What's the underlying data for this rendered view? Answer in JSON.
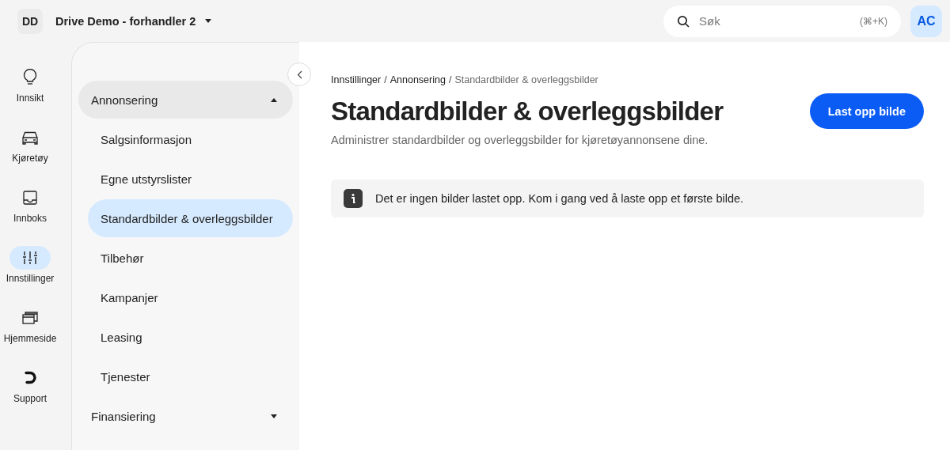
{
  "org": {
    "initials": "DD",
    "name": "Drive Demo - forhandler 2"
  },
  "search": {
    "placeholder": "Søk",
    "shortcut": "(⌘+K)"
  },
  "user": {
    "initials": "AC"
  },
  "rail": [
    {
      "label": "Innsikt",
      "selected": false
    },
    {
      "label": "Kjøretøy",
      "selected": false
    },
    {
      "label": "Innboks",
      "selected": false
    },
    {
      "label": "Innstillinger",
      "selected": true
    },
    {
      "label": "Hjemmeside",
      "selected": false
    },
    {
      "label": "Support",
      "selected": false
    }
  ],
  "menu": [
    {
      "kind": "group",
      "label": "Annonsering",
      "expanded": true,
      "children": [
        {
          "label": "Salgsinformasjon",
          "selected": false
        },
        {
          "label": "Egne utstyrslister",
          "selected": false
        },
        {
          "label": "Standardbilder & overleggsbilder",
          "selected": true
        },
        {
          "label": "Tilbehør",
          "selected": false
        },
        {
          "label": "Kampanjer",
          "selected": false
        },
        {
          "label": "Leasing",
          "selected": false
        },
        {
          "label": "Tjenester",
          "selected": false
        }
      ]
    },
    {
      "kind": "group",
      "label": "Finansiering",
      "expanded": false
    }
  ],
  "breadcrumb": {
    "separator": "/",
    "items": [
      "Innstillinger",
      "Annonsering",
      "Standardbilder & overleggsbilder"
    ]
  },
  "title": "Standardbilder & overleggsbilder",
  "subtitle": "Administrer standardbilder og overleggsbilder for kjøretøyannonsene dine.",
  "primary_button": "Last opp bilde",
  "notice": "Det er ingen bilder lastet opp. Kom i gang ved å laste opp et første bilde."
}
